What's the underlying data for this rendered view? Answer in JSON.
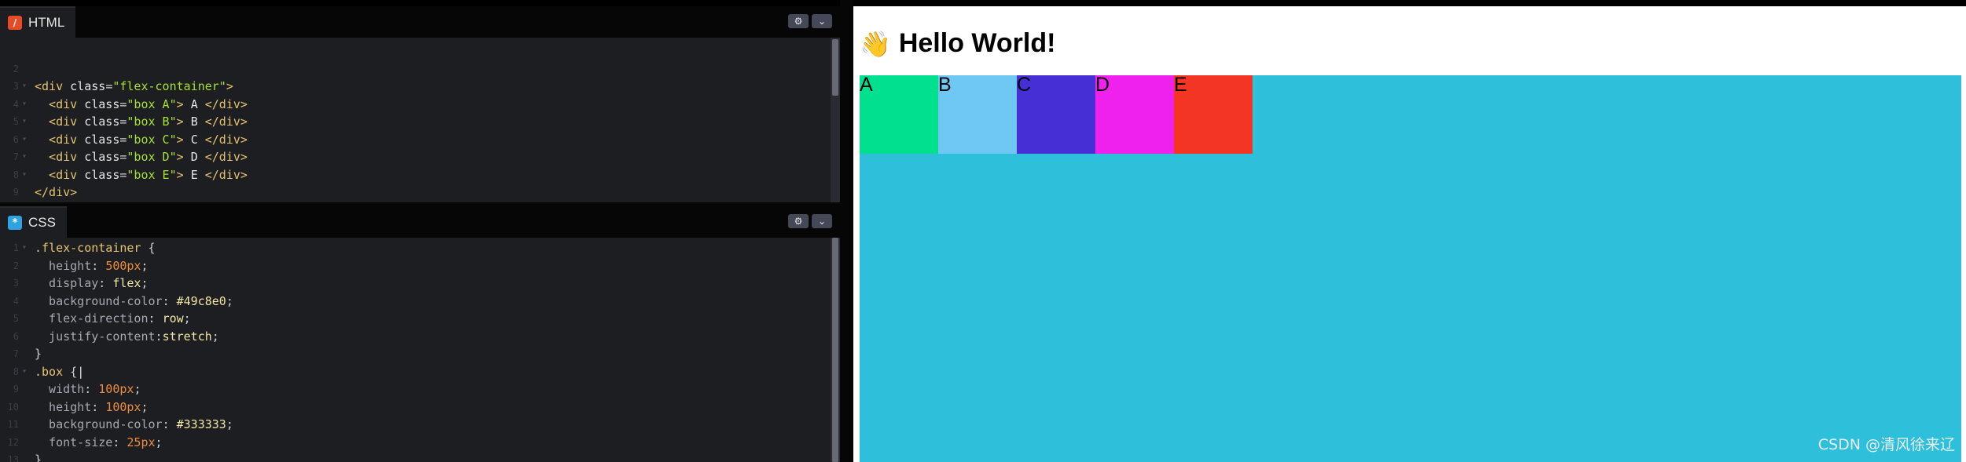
{
  "html_panel": {
    "tab_label": "HTML",
    "icon": "html-file-icon",
    "lines": [
      {
        "n": "",
        "segments": [
          {
            "t": "",
            "c": "t-punc"
          }
        ]
      },
      {
        "n": "2",
        "fold": "",
        "segments": [
          {
            "t": "",
            "c": "t-punc"
          }
        ]
      },
      {
        "n": "3",
        "fold": "▾",
        "segments": [
          {
            "t": "<div ",
            "c": "t-tag"
          },
          {
            "t": "class",
            "c": "t-attr"
          },
          {
            "t": "=",
            "c": "t-punc"
          },
          {
            "t": "\"flex-container\"",
            "c": "t-str"
          },
          {
            "t": ">",
            "c": "t-tag"
          }
        ]
      },
      {
        "n": "4",
        "fold": "▾",
        "segments": [
          {
            "t": "  <div ",
            "c": "t-tag"
          },
          {
            "t": "class",
            "c": "t-attr"
          },
          {
            "t": "=",
            "c": "t-punc"
          },
          {
            "t": "\"box A\"",
            "c": "t-str"
          },
          {
            "t": "> ",
            "c": "t-tag"
          },
          {
            "t": "A",
            "c": "t-attr"
          },
          {
            "t": " </div>",
            "c": "t-tag"
          }
        ]
      },
      {
        "n": "5",
        "fold": "▾",
        "segments": [
          {
            "t": "  <div ",
            "c": "t-tag"
          },
          {
            "t": "class",
            "c": "t-attr"
          },
          {
            "t": "=",
            "c": "t-punc"
          },
          {
            "t": "\"box B\"",
            "c": "t-str"
          },
          {
            "t": "> ",
            "c": "t-tag"
          },
          {
            "t": "B",
            "c": "t-attr"
          },
          {
            "t": " </div>",
            "c": "t-tag"
          }
        ]
      },
      {
        "n": "6",
        "fold": "▾",
        "segments": [
          {
            "t": "  <div ",
            "c": "t-tag"
          },
          {
            "t": "class",
            "c": "t-attr"
          },
          {
            "t": "=",
            "c": "t-punc"
          },
          {
            "t": "\"box C\"",
            "c": "t-str"
          },
          {
            "t": "> ",
            "c": "t-tag"
          },
          {
            "t": "C",
            "c": "t-attr"
          },
          {
            "t": " </div>",
            "c": "t-tag"
          }
        ]
      },
      {
        "n": "7",
        "fold": "▾",
        "segments": [
          {
            "t": "  <div ",
            "c": "t-tag"
          },
          {
            "t": "class",
            "c": "t-attr"
          },
          {
            "t": "=",
            "c": "t-punc"
          },
          {
            "t": "\"box D\"",
            "c": "t-str"
          },
          {
            "t": "> ",
            "c": "t-tag"
          },
          {
            "t": "D",
            "c": "t-attr"
          },
          {
            "t": " </div>",
            "c": "t-tag"
          }
        ]
      },
      {
        "n": "8",
        "fold": "▾",
        "segments": [
          {
            "t": "  <div ",
            "c": "t-tag"
          },
          {
            "t": "class",
            "c": "t-attr"
          },
          {
            "t": "=",
            "c": "t-punc"
          },
          {
            "t": "\"box E\"",
            "c": "t-str"
          },
          {
            "t": "> ",
            "c": "t-tag"
          },
          {
            "t": "E",
            "c": "t-attr"
          },
          {
            "t": " </div>",
            "c": "t-tag"
          }
        ]
      },
      {
        "n": "9",
        "fold": "",
        "segments": [
          {
            "t": "</div>",
            "c": "t-tag"
          }
        ]
      }
    ]
  },
  "css_panel": {
    "tab_label": "CSS",
    "icon": "css-file-icon",
    "lines": [
      {
        "n": "1",
        "fold": "▾",
        "segments": [
          {
            "t": ".flex-container",
            "c": "t-sel"
          },
          {
            "t": " {",
            "c": "t-punc"
          }
        ]
      },
      {
        "n": "2",
        "fold": "",
        "segments": [
          {
            "t": "  height",
            "c": "t-prop"
          },
          {
            "t": ": ",
            "c": "t-punc"
          },
          {
            "t": "500px",
            "c": "t-num"
          },
          {
            "t": ";",
            "c": "t-punc"
          }
        ]
      },
      {
        "n": "3",
        "fold": "",
        "segments": [
          {
            "t": "  display",
            "c": "t-prop"
          },
          {
            "t": ": ",
            "c": "t-punc"
          },
          {
            "t": "flex",
            "c": "t-val"
          },
          {
            "t": ";",
            "c": "t-punc"
          }
        ]
      },
      {
        "n": "4",
        "fold": "",
        "segments": [
          {
            "t": "  background-color",
            "c": "t-prop"
          },
          {
            "t": ": ",
            "c": "t-punc"
          },
          {
            "t": "#49c8e0",
            "c": "t-val"
          },
          {
            "t": ";",
            "c": "t-punc"
          }
        ]
      },
      {
        "n": "5",
        "fold": "",
        "segments": [
          {
            "t": "  flex-direction",
            "c": "t-prop"
          },
          {
            "t": ": ",
            "c": "t-punc"
          },
          {
            "t": "row",
            "c": "t-val"
          },
          {
            "t": ";",
            "c": "t-punc"
          }
        ]
      },
      {
        "n": "6",
        "fold": "",
        "segments": [
          {
            "t": "  justify-content",
            "c": "t-prop"
          },
          {
            "t": ":",
            "c": "t-punc"
          },
          {
            "t": "stretch",
            "c": "t-val"
          },
          {
            "t": ";",
            "c": "t-punc"
          }
        ]
      },
      {
        "n": "7",
        "fold": "",
        "segments": [
          {
            "t": "}",
            "c": "t-punc"
          }
        ]
      },
      {
        "n": "8",
        "fold": "▾",
        "segments": [
          {
            "t": ".box",
            "c": "t-sel"
          },
          {
            "t": " {",
            "c": "t-punc"
          },
          {
            "t": "|",
            "c": "t-attr"
          }
        ]
      },
      {
        "n": "9",
        "fold": "",
        "segments": [
          {
            "t": "  width",
            "c": "t-prop"
          },
          {
            "t": ": ",
            "c": "t-punc"
          },
          {
            "t": "100px",
            "c": "t-num"
          },
          {
            "t": ";",
            "c": "t-punc"
          }
        ]
      },
      {
        "n": "10",
        "fold": "",
        "segments": [
          {
            "t": "  height",
            "c": "t-prop"
          },
          {
            "t": ": ",
            "c": "t-punc"
          },
          {
            "t": "100px",
            "c": "t-num"
          },
          {
            "t": ";",
            "c": "t-punc"
          }
        ]
      },
      {
        "n": "11",
        "fold": "",
        "segments": [
          {
            "t": "  background-color",
            "c": "t-prop"
          },
          {
            "t": ": ",
            "c": "t-punc"
          },
          {
            "t": "#333333",
            "c": "t-val"
          },
          {
            "t": ";",
            "c": "t-punc"
          }
        ]
      },
      {
        "n": "12",
        "fold": "",
        "segments": [
          {
            "t": "  font-size",
            "c": "t-prop"
          },
          {
            "t": ": ",
            "c": "t-punc"
          },
          {
            "t": "25px",
            "c": "t-num"
          },
          {
            "t": ";",
            "c": "t-punc"
          }
        ]
      },
      {
        "n": "13",
        "fold": "",
        "segments": [
          {
            "t": "}",
            "c": "t-punc"
          }
        ]
      }
    ]
  },
  "toolbar": {
    "settings_icon": "gear-icon",
    "collapse_icon": "chevron-down-icon"
  },
  "preview": {
    "heading_text": "Hello World!",
    "heading_icon": "waving-hand-icon",
    "container_color": "#2ebfda",
    "boxes": [
      {
        "label": "A",
        "color": "#00e08f"
      },
      {
        "label": "B",
        "color": "#6fc8f3"
      },
      {
        "label": "C",
        "color": "#462fd5"
      },
      {
        "label": "D",
        "color": "#ef22ed"
      },
      {
        "label": "E",
        "color": "#f33524"
      }
    ],
    "watermark": "CSDN @清风徐来辽"
  }
}
